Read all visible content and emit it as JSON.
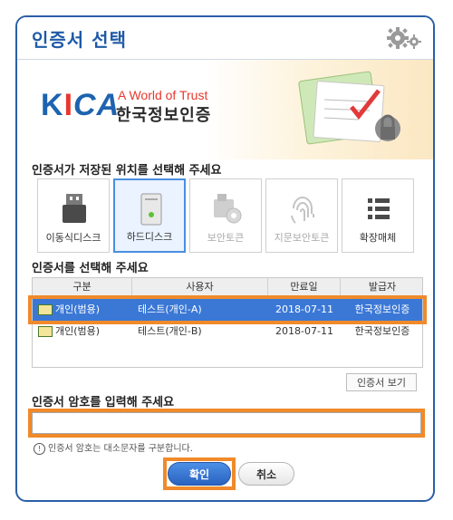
{
  "dialog": {
    "title": "인증서 선택"
  },
  "banner": {
    "logo_text": "KICA",
    "tagline": "A World of Trust",
    "company": "한국정보인증"
  },
  "storage_section": {
    "label": "인증서가 저장된 위치를 선택해 주세요",
    "items": [
      {
        "label": "이동식디스크",
        "icon": "usb-drive-icon",
        "state": "enabled"
      },
      {
        "label": "하드디스크",
        "icon": "hard-disk-icon",
        "state": "selected"
      },
      {
        "label": "보안토큰",
        "icon": "security-token-icon",
        "state": "disabled"
      },
      {
        "label": "지문보안토큰",
        "icon": "fingerprint-icon",
        "state": "disabled"
      },
      {
        "label": "확장매체",
        "icon": "list-icon",
        "state": "enabled"
      }
    ]
  },
  "cert_section": {
    "label": "인증서를 선택해 주세요",
    "columns": [
      "구분",
      "사용자",
      "만료일",
      "발급자"
    ],
    "rows": [
      {
        "type": "개인(범용)",
        "user": "테스트(개인-A)",
        "expiry": "2018-07-11",
        "issuer": "한국정보인증",
        "selected": true
      },
      {
        "type": "개인(범용)",
        "user": "테스트(개인-B)",
        "expiry": "2018-07-11",
        "issuer": "한국정보인증",
        "selected": false
      }
    ],
    "view_button": "인증서 보기"
  },
  "password_section": {
    "label": "인증서 암호를 입력해 주세요",
    "value": "",
    "hint": "인증서 암호는 대소문자를 구분합니다."
  },
  "buttons": {
    "ok": "확인",
    "cancel": "취소"
  },
  "colors": {
    "accent": "#1f5aa6",
    "selection": "#3b78d6",
    "highlight": "#f08a2a"
  }
}
